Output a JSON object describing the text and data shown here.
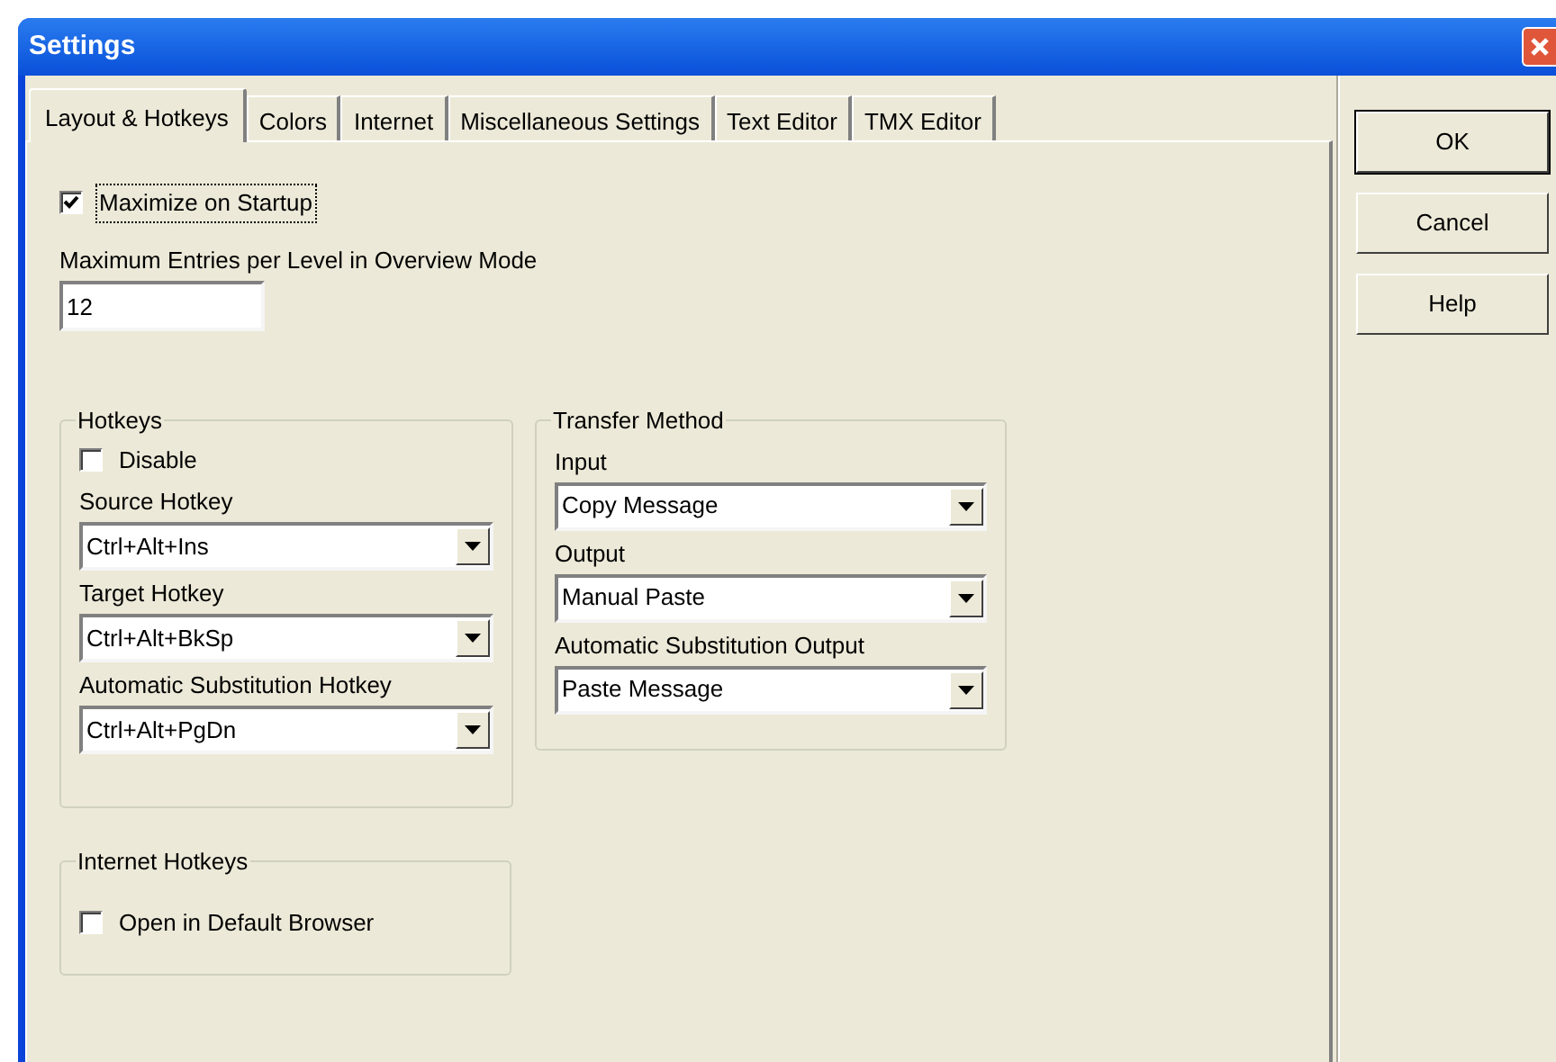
{
  "window": {
    "title": "Settings"
  },
  "tabs": [
    {
      "label": "Layout & Hotkeys",
      "selected": true
    },
    {
      "label": "Colors",
      "selected": false
    },
    {
      "label": "Internet",
      "selected": false
    },
    {
      "label": "Miscellaneous Settings",
      "selected": false
    },
    {
      "label": "Text Editor",
      "selected": false
    },
    {
      "label": "TMX Editor",
      "selected": false
    }
  ],
  "maximize_on_startup": {
    "label": "Maximize on Startup",
    "checked": true,
    "focused": true
  },
  "max_entries": {
    "label": "Maximum Entries per Level in Overview Mode",
    "value": "12"
  },
  "hotkeys": {
    "title": "Hotkeys",
    "disable": {
      "label": "Disable",
      "checked": false
    },
    "fields": [
      {
        "label": "Source Hotkey",
        "value": "Ctrl+Alt+Ins"
      },
      {
        "label": "Target Hotkey",
        "value": "Ctrl+Alt+BkSp"
      },
      {
        "label": "Automatic Substitution Hotkey",
        "value": "Ctrl+Alt+PgDn"
      }
    ]
  },
  "transfer_method": {
    "title": "Transfer Method",
    "fields": [
      {
        "label": "Input",
        "value": "Copy Message"
      },
      {
        "label": "Output",
        "value": "Manual Paste"
      },
      {
        "label": "Automatic Substitution Output",
        "value": "Paste Message"
      }
    ]
  },
  "internet_hotkeys": {
    "title": "Internet Hotkeys",
    "open_in_browser": {
      "label": "Open in Default Browser",
      "checked": false
    }
  },
  "buttons": [
    {
      "label": "OK",
      "default": true
    },
    {
      "label": "Cancel",
      "default": false
    },
    {
      "label": "Help",
      "default": false
    }
  ]
}
